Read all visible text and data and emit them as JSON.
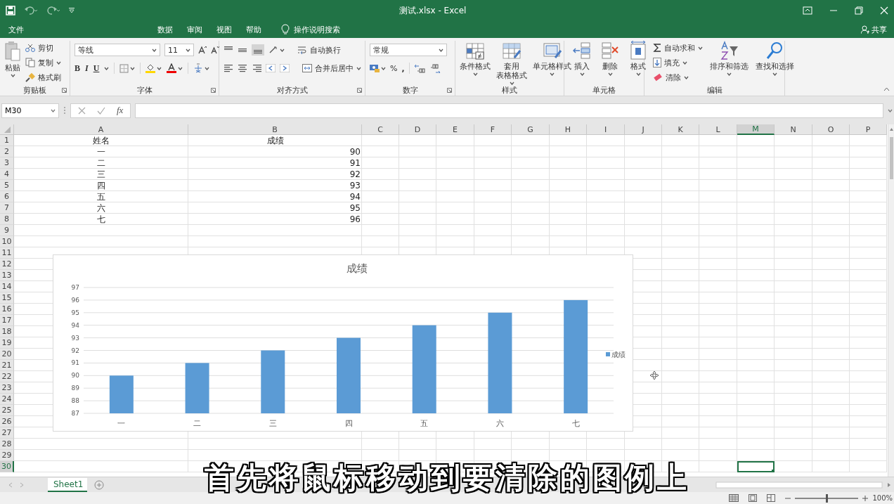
{
  "window": {
    "title": "测试.xlsx - Excel"
  },
  "ribbon_tabs": [
    {
      "label": "文件",
      "selected": false
    },
    {
      "label": "数据",
      "selected": false
    },
    {
      "label": "审阅",
      "selected": false
    },
    {
      "label": "视图",
      "selected": false
    },
    {
      "label": "帮助",
      "selected": false
    }
  ],
  "tell_me": "操作说明搜索",
  "share": "共享",
  "clipboard": {
    "label": "剪贴板",
    "paste": "粘贴",
    "cut": "剪切",
    "copy": "复制",
    "format_painter": "格式刷"
  },
  "font": {
    "label": "字体",
    "font_name": "等线",
    "font_size": "11",
    "bold": "B",
    "italic": "I",
    "underline": "U"
  },
  "alignment": {
    "label": "对齐方式",
    "wrap_text": "自动换行",
    "merge_center": "合并后居中"
  },
  "number": {
    "label": "数字",
    "format": "常规",
    "percent": "%",
    "comma": ","
  },
  "styles": {
    "label": "样式",
    "conditional": "条件格式",
    "table_format": [
      "套用",
      "表格格式"
    ],
    "cell_styles": "单元格样式"
  },
  "cells_group": {
    "label": "单元格",
    "insert": "插入",
    "delete": "删除",
    "format": "格式"
  },
  "editing": {
    "label": "编辑",
    "autosum": "自动求和",
    "fill": "填充",
    "clear": "清除",
    "sort_filter": "排序和筛选",
    "find_select": "查找和选择"
  },
  "name_box": "M30",
  "formula_button": "fx",
  "columns": [
    {
      "label": "A",
      "selected": false
    },
    {
      "label": "B",
      "selected": false
    },
    {
      "label": "C",
      "selected": false
    },
    {
      "label": "D",
      "selected": false
    },
    {
      "label": "E",
      "selected": false
    },
    {
      "label": "F",
      "selected": false
    },
    {
      "label": "G",
      "selected": false
    },
    {
      "label": "H",
      "selected": false
    },
    {
      "label": "I",
      "selected": false
    },
    {
      "label": "J",
      "selected": false
    },
    {
      "label": "K",
      "selected": false
    },
    {
      "label": "L",
      "selected": false
    },
    {
      "label": "M",
      "selected": true
    },
    {
      "label": "N",
      "selected": false
    },
    {
      "label": "O",
      "selected": false
    },
    {
      "label": "P",
      "selected": false
    }
  ],
  "rows": [
    {
      "label": "1",
      "selected": false
    },
    {
      "label": "2",
      "selected": false
    },
    {
      "label": "3",
      "selected": false
    },
    {
      "label": "4",
      "selected": false
    },
    {
      "label": "5",
      "selected": false
    },
    {
      "label": "6",
      "selected": false
    },
    {
      "label": "7",
      "selected": false
    },
    {
      "label": "8",
      "selected": false
    },
    {
      "label": "9",
      "selected": false
    },
    {
      "label": "10",
      "selected": false
    },
    {
      "label": "11",
      "selected": false
    },
    {
      "label": "12",
      "selected": false
    },
    {
      "label": "13",
      "selected": false
    },
    {
      "label": "14",
      "selected": false
    },
    {
      "label": "15",
      "selected": false
    },
    {
      "label": "16",
      "selected": false
    },
    {
      "label": "17",
      "selected": false
    },
    {
      "label": "18",
      "selected": false
    },
    {
      "label": "19",
      "selected": false
    },
    {
      "label": "20",
      "selected": false
    },
    {
      "label": "21",
      "selected": false
    },
    {
      "label": "22",
      "selected": false
    },
    {
      "label": "23",
      "selected": false
    },
    {
      "label": "24",
      "selected": false
    },
    {
      "label": "25",
      "selected": false
    },
    {
      "label": "26",
      "selected": false
    },
    {
      "label": "27",
      "selected": false
    },
    {
      "label": "28",
      "selected": false
    },
    {
      "label": "29",
      "selected": false
    },
    {
      "label": "30",
      "selected": true
    }
  ],
  "cells": [
    [
      {
        "text": "姓名",
        "kind": "text"
      },
      {
        "text": "成绩",
        "kind": "text"
      }
    ],
    [
      {
        "text": "一",
        "kind": "text"
      },
      {
        "text": "90",
        "kind": "number"
      }
    ],
    [
      {
        "text": "二",
        "kind": "text"
      },
      {
        "text": "91",
        "kind": "number"
      }
    ],
    [
      {
        "text": "三",
        "kind": "text"
      },
      {
        "text": "92",
        "kind": "number"
      }
    ],
    [
      {
        "text": "四",
        "kind": "text"
      },
      {
        "text": "93",
        "kind": "number"
      }
    ],
    [
      {
        "text": "五",
        "kind": "text"
      },
      {
        "text": "94",
        "kind": "number"
      }
    ],
    [
      {
        "text": "六",
        "kind": "text"
      },
      {
        "text": "95",
        "kind": "number"
      }
    ],
    [
      {
        "text": "七",
        "kind": "text"
      },
      {
        "text": "96",
        "kind": "number"
      }
    ]
  ],
  "chart": {
    "chart_data": {
      "type": "bar",
      "title": "成绩",
      "categories": [
        "一",
        "二",
        "三",
        "四",
        "五",
        "六",
        "七"
      ],
      "series": [
        {
          "name": "成绩",
          "color": "#5b9bd5",
          "values": [
            90,
            91,
            92,
            93,
            94,
            95,
            96
          ]
        }
      ],
      "ylim": [
        87,
        97
      ],
      "grid": true,
      "yticks": [
        87,
        88,
        89,
        90,
        91,
        92,
        93,
        94,
        95,
        96,
        97
      ]
    }
  },
  "sheet_tabs": [
    {
      "label": "Sheet1",
      "selected": true
    }
  ],
  "zoom": {
    "level": 0.5,
    "reading": "100%"
  },
  "subtitle": "首先将鼠标移动到要清除的图例上"
}
